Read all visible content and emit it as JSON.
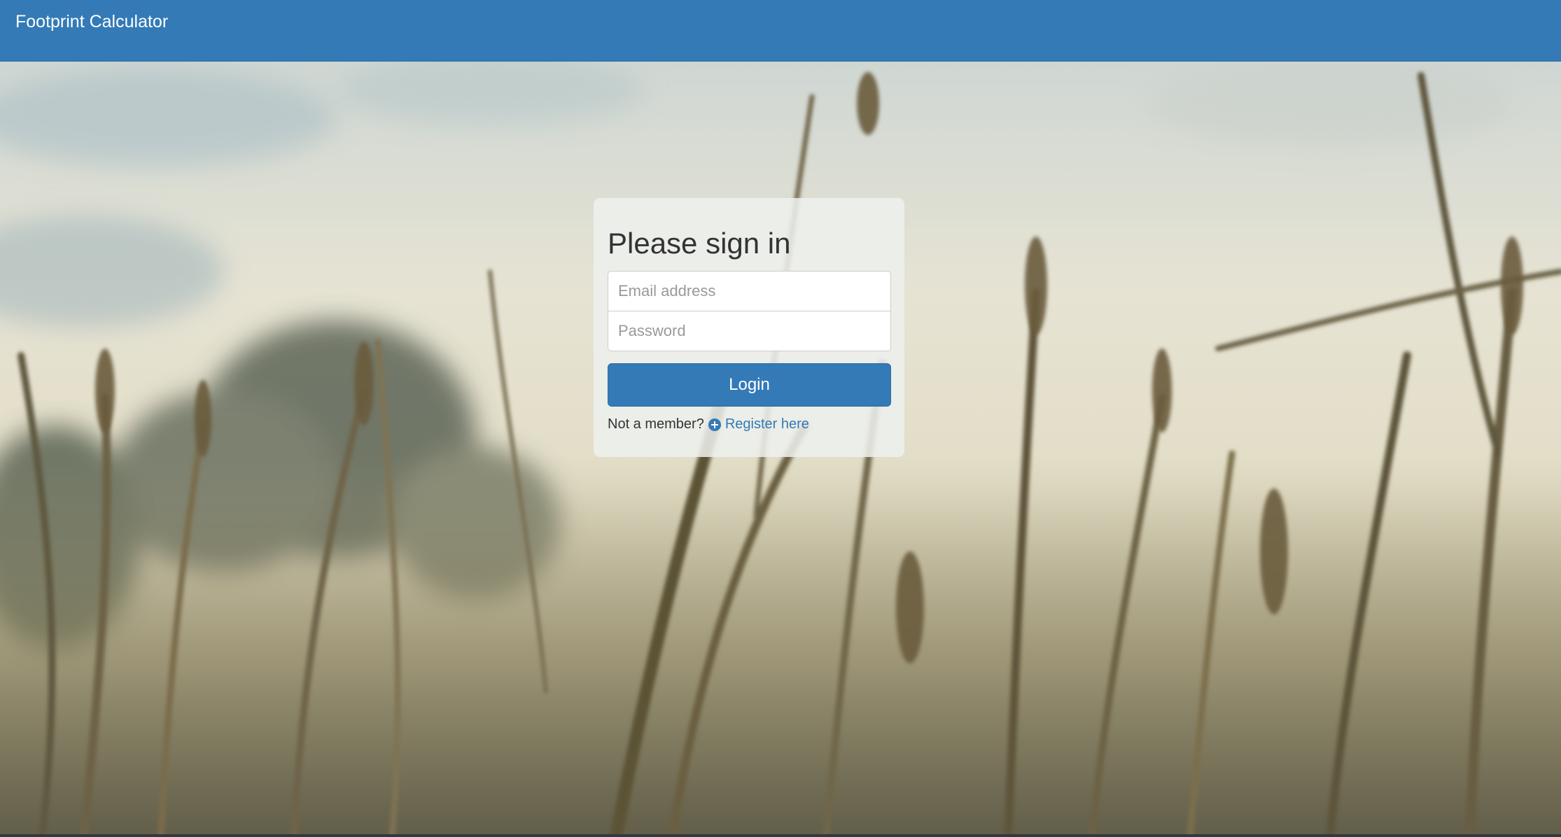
{
  "navbar": {
    "brand": "Footprint Calculator"
  },
  "login": {
    "heading": "Please sign in",
    "email_placeholder": "Email address",
    "password_placeholder": "Password",
    "email_value": "",
    "password_value": "",
    "submit_label": "Login",
    "not_member_text": "Not a member?",
    "register_label": "Register here",
    "register_icon": "plus-circle-icon"
  },
  "colors": {
    "primary": "#337ab7",
    "primary_border": "#2e6da4",
    "text": "#333333",
    "panel": "#eef0ed"
  }
}
